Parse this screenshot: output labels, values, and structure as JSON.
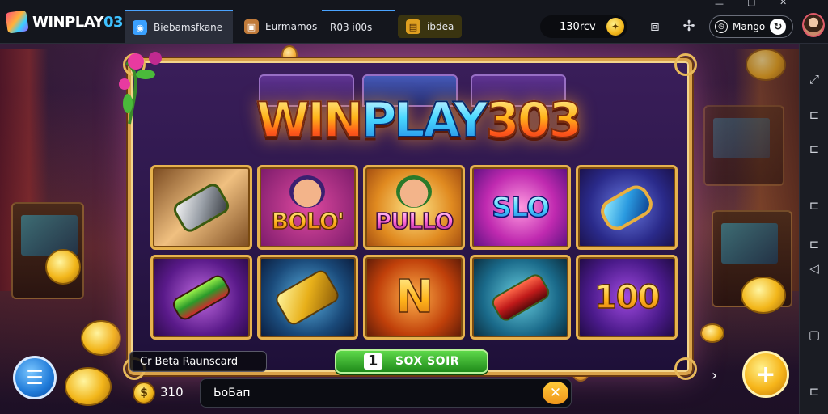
{
  "app": {
    "logo_text_main": "WINPLAY",
    "logo_text_accent": "03"
  },
  "tabs": [
    {
      "label": "Biebamsfkane",
      "icon": "gamepad-icon"
    },
    {
      "label": "Eurmamos",
      "icon": "portrait-icon"
    },
    {
      "label": "R03 i00s",
      "icon": ""
    },
    {
      "label": "ibdea",
      "icon": "box-icon"
    }
  ],
  "header": {
    "coin_balance": "130rcv",
    "username": "Mango"
  },
  "game": {
    "title_part1": "WIN",
    "title_part2": "PLAY",
    "title_part3": "303",
    "symbols": [
      {
        "label": "",
        "kind": "silver-gem"
      },
      {
        "label": "BOLO'",
        "kind": "character"
      },
      {
        "label": "PULLO",
        "kind": "character"
      },
      {
        "label": "SLO",
        "kind": "ball"
      },
      {
        "label": "",
        "kind": "blue-gem"
      },
      {
        "label": "",
        "kind": "green-bug"
      },
      {
        "label": "",
        "kind": "gold-cylinder"
      },
      {
        "label": "N",
        "kind": "letter"
      },
      {
        "label": "",
        "kind": "red-cylinder"
      },
      {
        "label": "100",
        "kind": "number"
      }
    ]
  },
  "controls": {
    "balance_label": "Cr Beta Raunscard",
    "spin_number": "1",
    "spin_label": "SOX SOIR",
    "coin_count": "310",
    "input_value": "ЬоБап",
    "close_glyph": "✕"
  },
  "colors": {
    "accent_gold": "#f2b61a",
    "accent_green": "#1f8a1a",
    "accent_blue": "#1f7ad8",
    "frame_gold": "#d9a24a"
  }
}
